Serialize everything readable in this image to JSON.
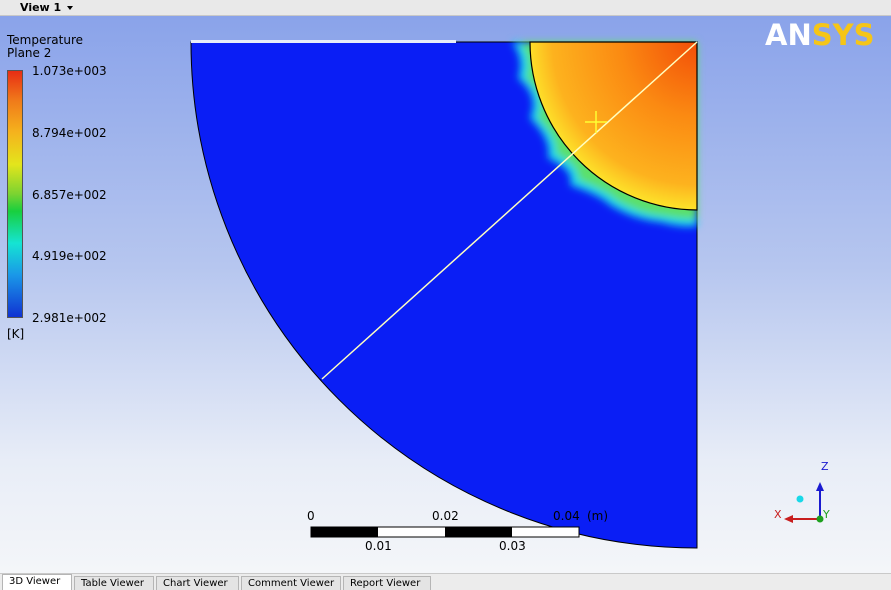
{
  "toolbar": {
    "view_label": "View 1"
  },
  "legend": {
    "title": "Temperature",
    "plane": "Plane 2",
    "values": [
      "1.073e+003",
      "8.794e+002",
      "6.857e+002",
      "4.919e+002",
      "2.981e+002"
    ],
    "unit": "[K]",
    "colors": [
      "#e82d14",
      "#f5b31d",
      "#18cf3e",
      "#15e4d3",
      "#1032d2"
    ]
  },
  "logo": {
    "main": "AN",
    "accent": "SYS",
    "accent_color": "#f5c518"
  },
  "scale": {
    "top_labels": [
      "0",
      "0.02",
      "0.04"
    ],
    "unit": "(m)",
    "bottom_labels": [
      "0.01",
      "0.03"
    ]
  },
  "axes": {
    "z": "Z",
    "x": "X",
    "y": "Y"
  },
  "tabs": [
    "3D Viewer",
    "Table Viewer",
    "Chart Viewer",
    "Comment Viewer",
    "Report Viewer"
  ],
  "colors": {
    "field_blue": "#0a1ef5",
    "hot_orange": "#ff8c1a",
    "background_top": "#8aa3ea"
  }
}
